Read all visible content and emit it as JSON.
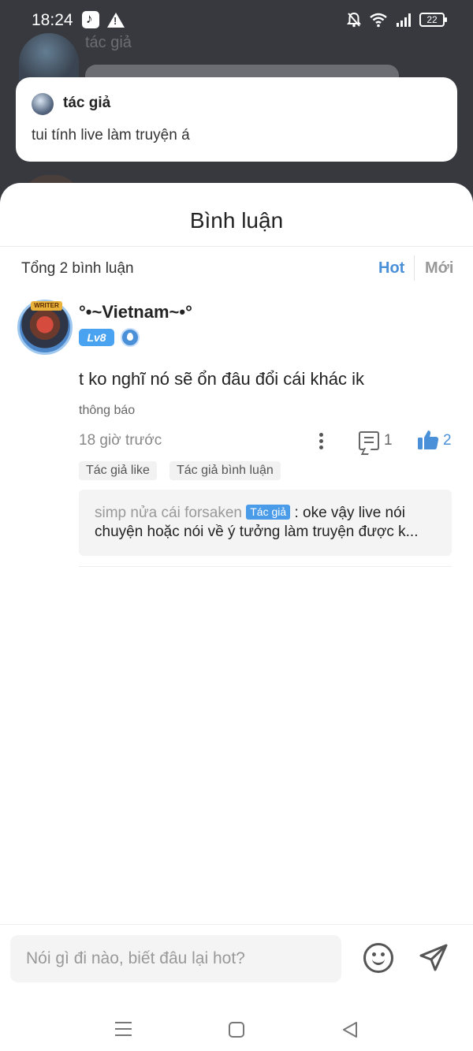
{
  "status_bar": {
    "time": "18:24",
    "battery": "22"
  },
  "background": {
    "author_name": "tác giả"
  },
  "pinned": {
    "name": "tác giả",
    "text": "tui tính live làm truyện á"
  },
  "sheet": {
    "title": "Bình luận",
    "total": "Tổng 2 bình luận",
    "sort_hot": "Hot",
    "sort_new": "Mới"
  },
  "comment": {
    "avatar_tag": "WRITER",
    "username": "°•~Vietnam~•°",
    "level": "Lv8",
    "text": "t ko nghĩ nó sẽ ổn đâu đổi cái khác ik",
    "note": "thông báo",
    "time": "18 giờ trước",
    "reply_count": "1",
    "like_count": "2",
    "tags": [
      "Tác giả like",
      "Tác giả bình luận"
    ],
    "reply": {
      "author": "simp nửa cái forsaken",
      "badge": "Tác giả",
      "text_line1": " : oke vậy live nói",
      "text_line2": "chuyện hoặc nói về ý tưởng làm truyện được k..."
    }
  },
  "input": {
    "placeholder": "Nói gì đi nào, biết đâu lại hot?"
  },
  "colors": {
    "accent": "#4a90d9",
    "level_badge": "#4aa3f0",
    "author_badge": "#4a9be8",
    "overlay_bg": "#38393f"
  },
  "icons": [
    "tiktok-icon",
    "warning-icon",
    "bell-off-icon",
    "wifi-icon",
    "signal-icon",
    "battery-icon",
    "more-vertical-icon",
    "comment-icon",
    "thumbs-up-icon",
    "emoji-icon",
    "send-icon",
    "menu-icon",
    "home-icon",
    "back-icon"
  ]
}
